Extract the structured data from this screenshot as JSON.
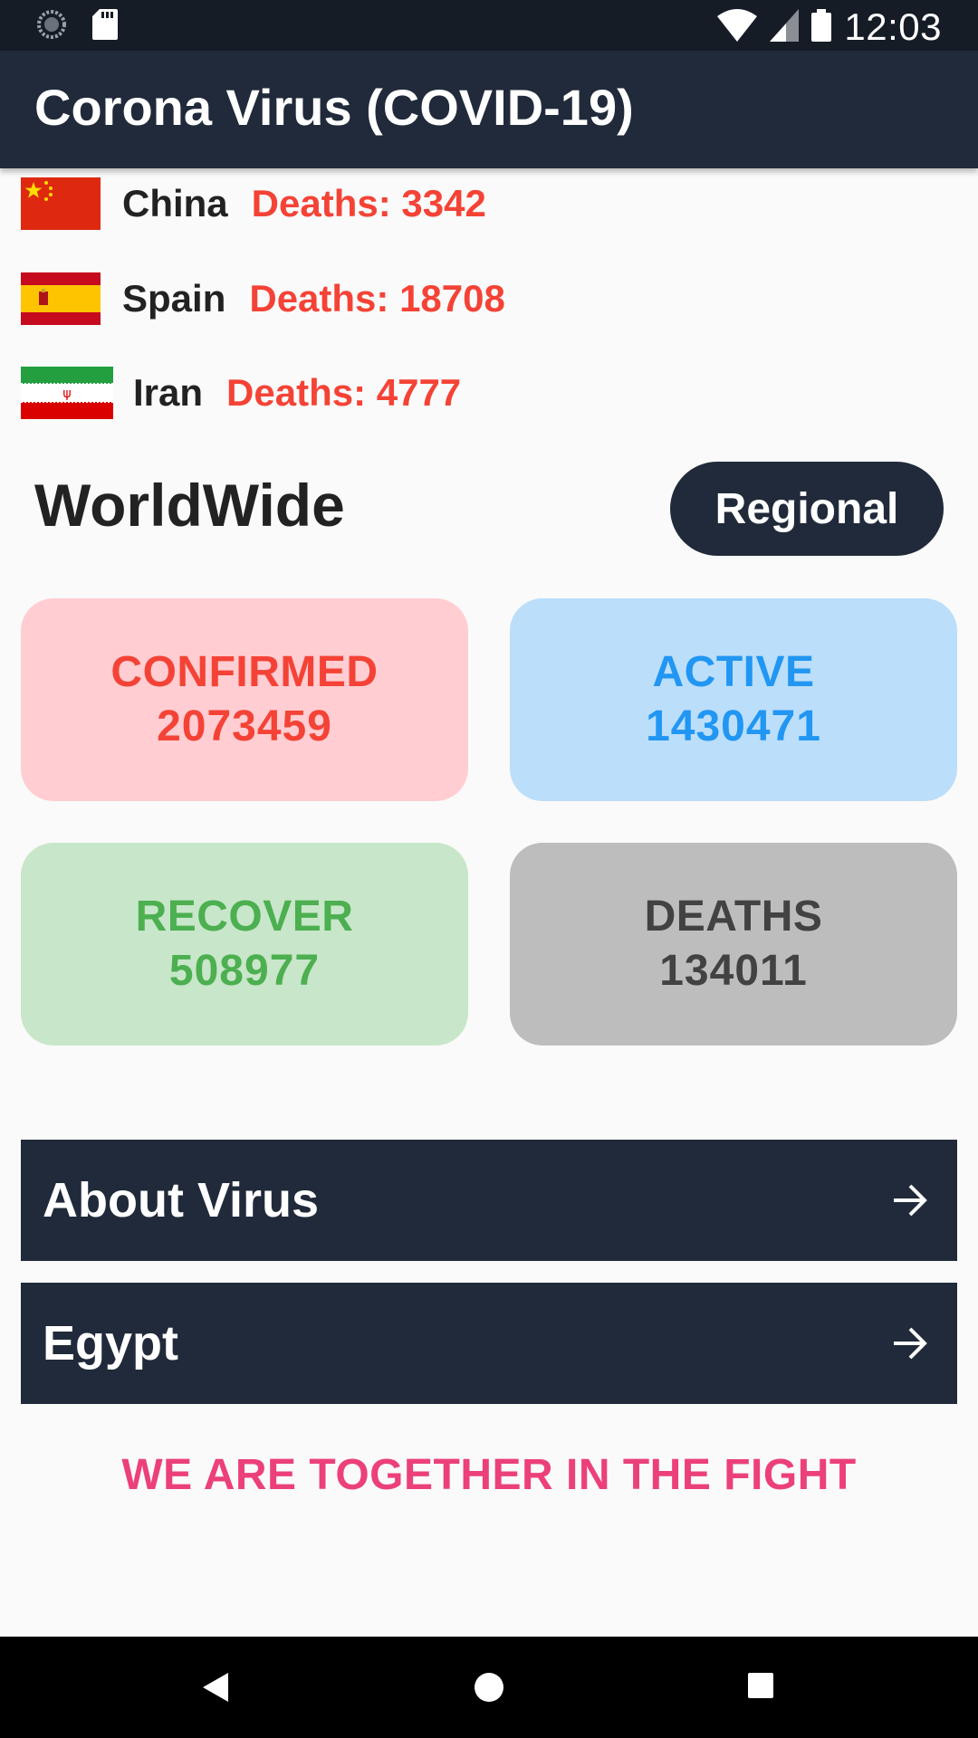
{
  "status_bar": {
    "time": "12:03",
    "icons": [
      "loading-icon",
      "sd-card-icon",
      "wifi-icon",
      "signal-icon",
      "battery-icon"
    ]
  },
  "app_bar": {
    "title": "Corona Virus (COVID-19)"
  },
  "top_countries": [
    {
      "flag": "china-flag",
      "name": "China",
      "deaths": "Deaths: 3342"
    },
    {
      "flag": "spain-flag",
      "name": "Spain",
      "deaths": "Deaths: 18708"
    },
    {
      "flag": "iran-flag",
      "name": "Iran",
      "deaths": "Deaths: 4777"
    }
  ],
  "worldwide": {
    "title": "WorldWide",
    "regional_button": "Regional",
    "stats": [
      {
        "label": "CONFIRMED",
        "value": "2073459",
        "bg": "#ffcdd2",
        "fg": "#f44336"
      },
      {
        "label": "ACTIVE",
        "value": "1430471",
        "bg": "#bbdefb",
        "fg": "#2196f3"
      },
      {
        "label": "RECOVER",
        "value": "508977",
        "bg": "#c8e6c9",
        "fg": "#4caf50"
      },
      {
        "label": "DEATHS",
        "value": "134011",
        "bg": "#bdbdbd",
        "fg": "#424242"
      }
    ]
  },
  "menu": [
    {
      "label": "About Virus",
      "icon": "arrow-right-icon"
    },
    {
      "label": "Egypt",
      "icon": "arrow-right-icon"
    }
  ],
  "slogan": "WE ARE TOGETHER IN THE FIGHT",
  "colors": {
    "primary_dark": "#212a3a",
    "status_bar": "#161c26",
    "accent_pink": "#ec407a",
    "death_red": "#f44336"
  },
  "system_nav": [
    "back-icon",
    "home-icon",
    "recents-icon"
  ]
}
